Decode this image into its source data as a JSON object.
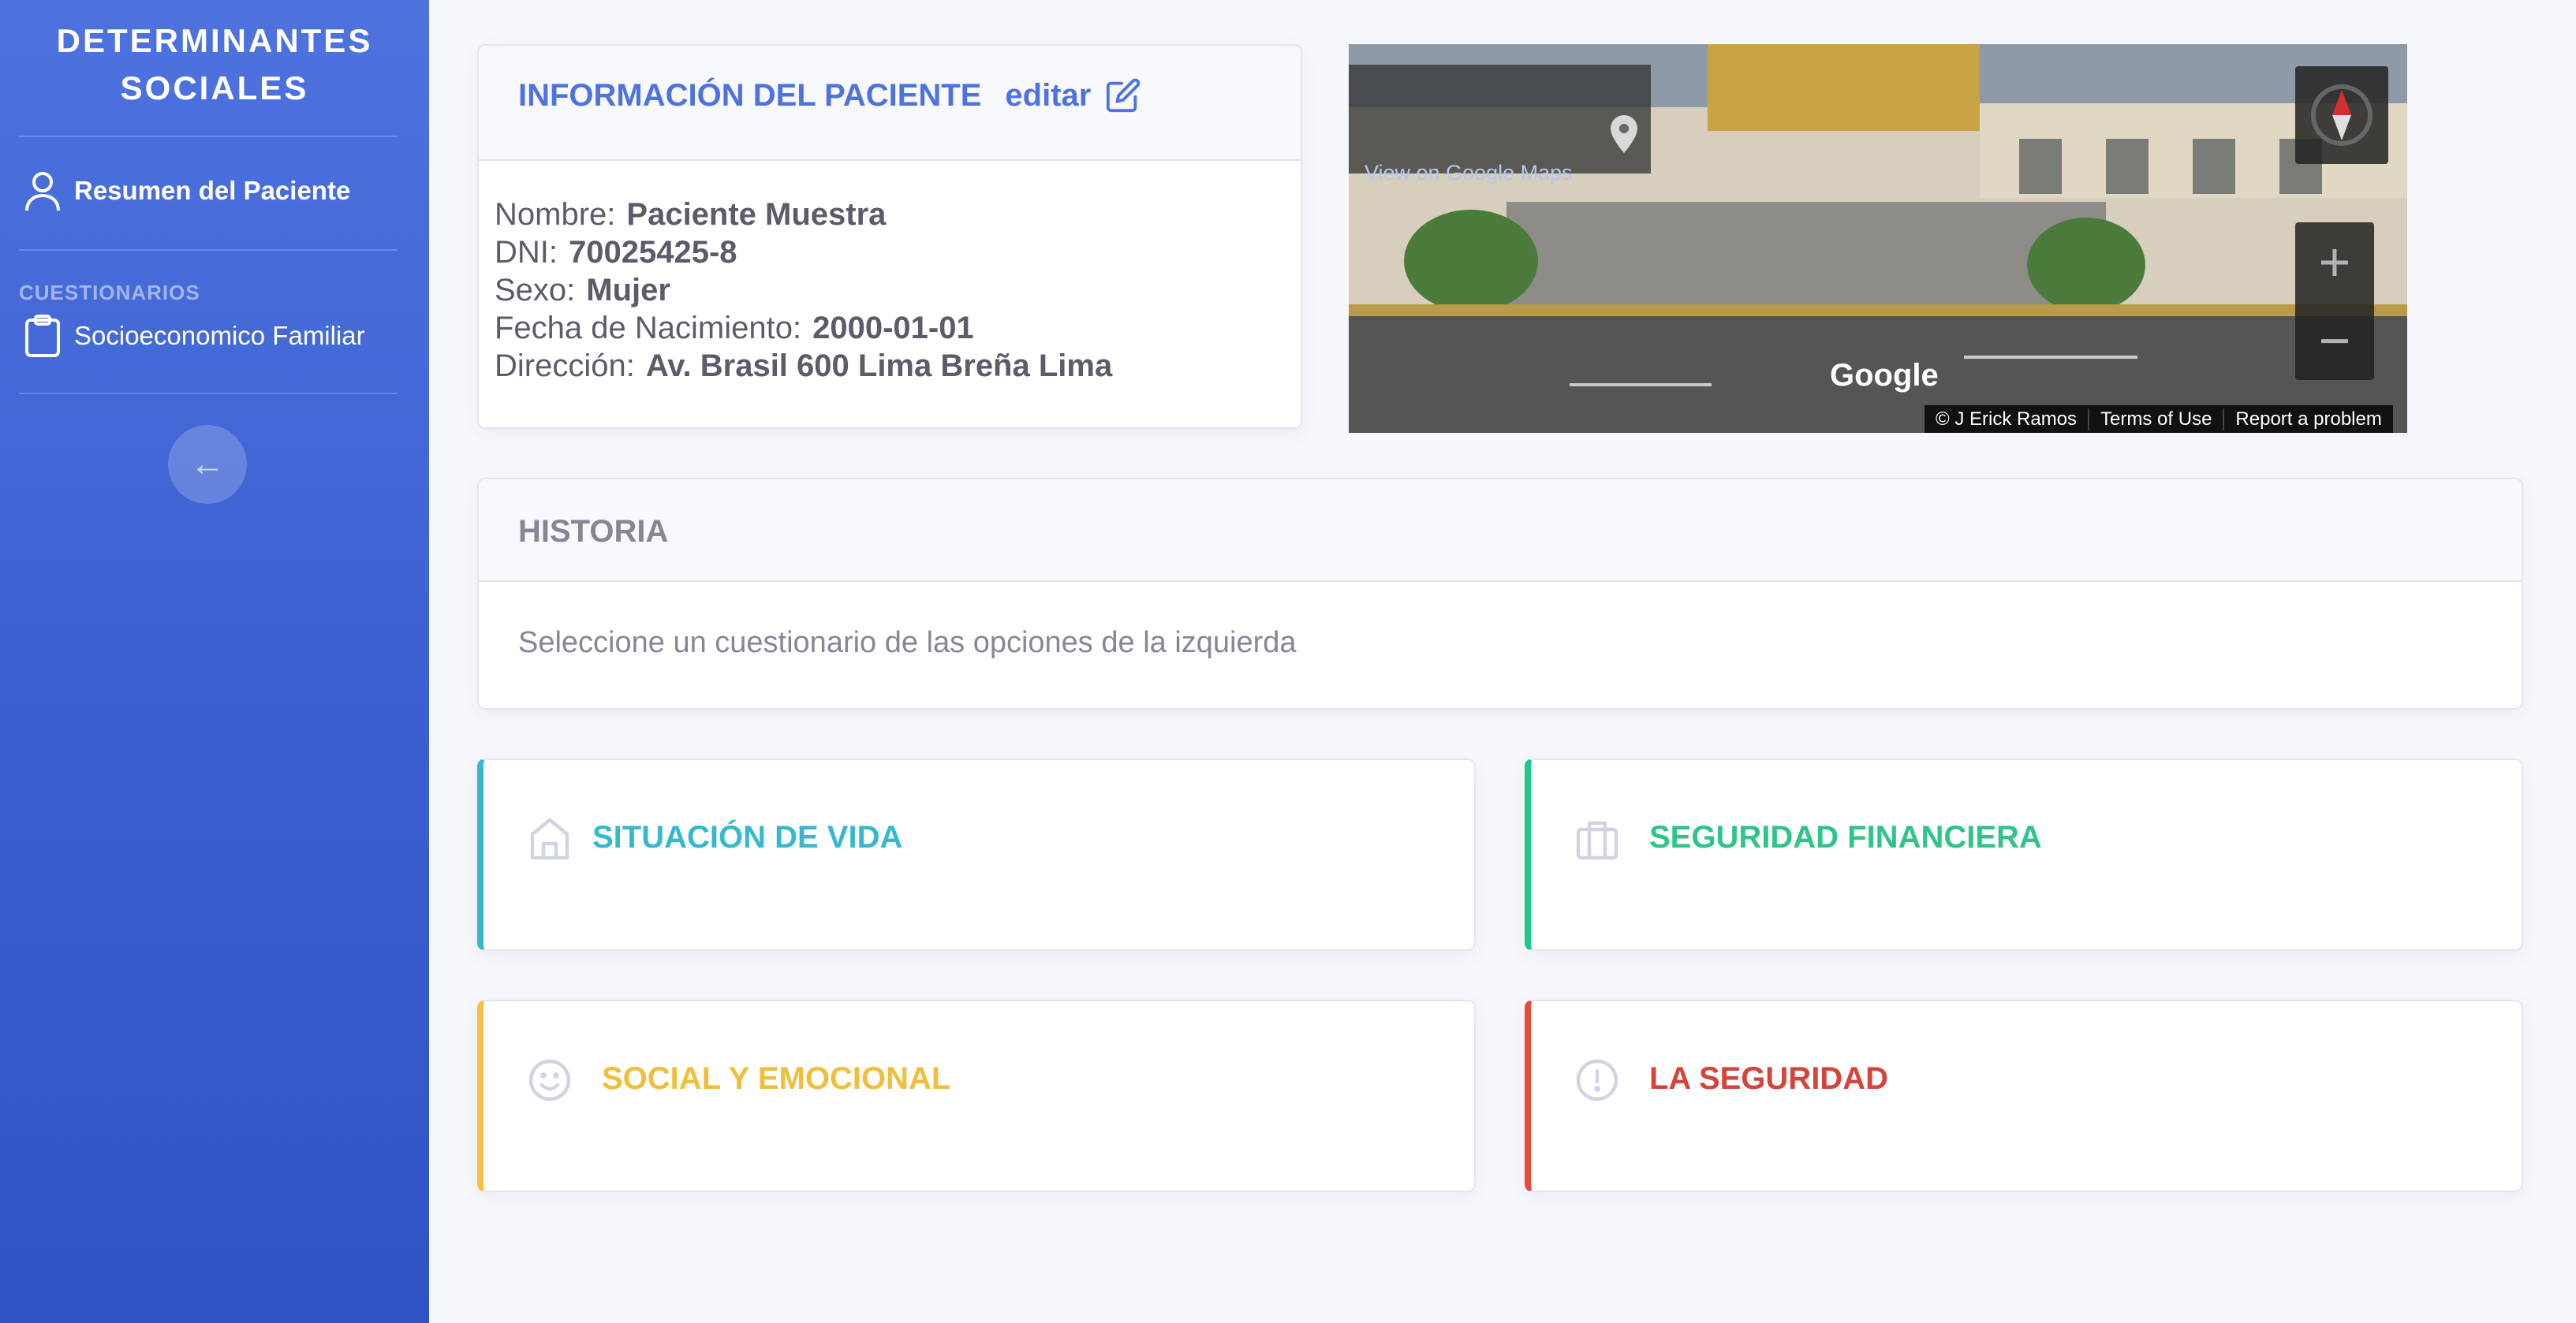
{
  "sidebar": {
    "brand_line1": "DETERMINANTES",
    "brand_line2": "SOCIALES",
    "summary_item": "Resumen del Paciente",
    "section_heading": "CUESTIONARIOS",
    "questionnaire_item": "Socioeconomico Familiar",
    "toggle_icon": "arrow-left-icon"
  },
  "patient": {
    "title": "INFORMACIÓN DEL PACIENTE",
    "edit_label": "editar",
    "fields": [
      {
        "label": "Nombre:",
        "value": "Paciente Muestra"
      },
      {
        "label": "DNI:",
        "value": "70025425-8"
      },
      {
        "label": "Sexo:",
        "value": "Mujer"
      },
      {
        "label": "Fecha de Nacimiento:",
        "value": "2000-01-01"
      },
      {
        "label": "Dirección:",
        "value": "Av. Brasil 600 Lima Breña Lima"
      }
    ]
  },
  "streetview": {
    "maps_link": "View on Google Maps",
    "logo": "Google",
    "attribution": "© J Erick Ramos",
    "terms": "Terms of Use",
    "report": "Report a problem",
    "zoom_in": "+",
    "zoom_out": "−"
  },
  "historia": {
    "title": "HISTORIA",
    "body": "Seleccione un cuestionario de las opciones de la izquierda"
  },
  "categories": [
    {
      "label": "SITUACIÓN DE VIDA",
      "icon": "home-icon",
      "color": "#36b9cc"
    },
    {
      "label": "SEGURIDAD FINANCIERA",
      "icon": "briefcase-icon",
      "color": "#1cc88a"
    },
    {
      "label": "SOCIAL Y EMOCIONAL",
      "icon": "smile-icon",
      "color": "#f6c23e"
    },
    {
      "label": "LA SEGURIDAD",
      "icon": "alert-circle-icon",
      "color": "#e74a3b"
    }
  ],
  "colors": {
    "primary": "#4e73df",
    "background": "#f7f8fc"
  }
}
